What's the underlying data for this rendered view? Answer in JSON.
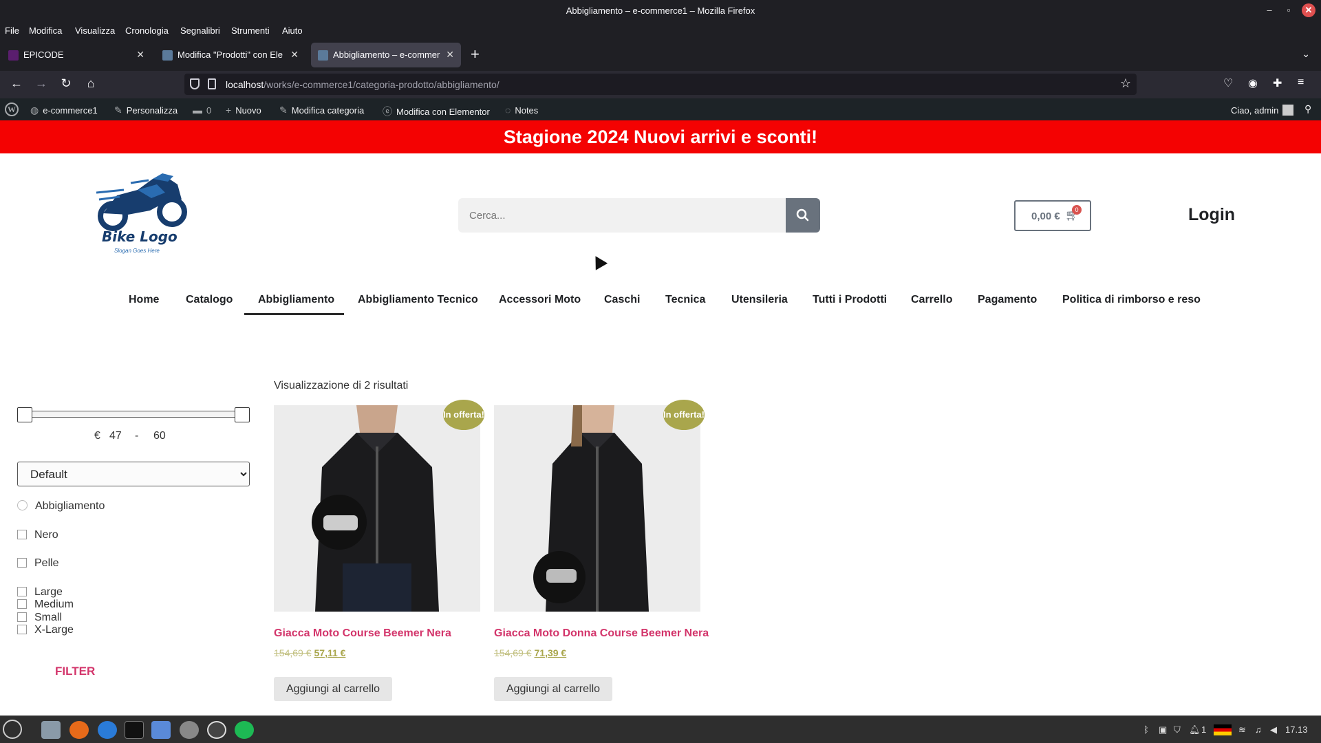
{
  "window": {
    "title": "Abbigliamento – e-commerce1 – Mozilla Firefox"
  },
  "menu": [
    "File",
    "Modifica",
    "Visualizza",
    "Cronologia",
    "Segnalibri",
    "Strumenti",
    "Aiuto"
  ],
  "tabs": [
    {
      "label": "EPICODE"
    },
    {
      "label": "Modifica \"Prodotti\" con Ele"
    },
    {
      "label": "Abbigliamento – e-commer"
    }
  ],
  "url": {
    "host": "localhost",
    "path": "/works/e-commerce1/categoria-prodotto/abbigliamento/"
  },
  "adminbar": {
    "site": "e-commerce1",
    "customize": "Personalizza",
    "comments": "0",
    "new": "Nuovo",
    "edit_category": "Modifica categoria",
    "elementor": "Modifica con Elementor",
    "notes": "Notes",
    "greeting": "Ciao, admin"
  },
  "promo": "Stagione 2024 Nuovi arrivi e sconti!",
  "logo": {
    "brand": "Bike Logo",
    "slogan": "Slogan Goes Here"
  },
  "search": {
    "placeholder": "Cerca..."
  },
  "cart": {
    "amount": "0,00 €",
    "count": "0"
  },
  "login": "Login",
  "nav": [
    "Home",
    "Catalogo",
    "Abbigliamento",
    "Abbigliamento Tecnico",
    "Accessori Moto",
    "Caschi",
    "Tecnica",
    "Utensileria",
    "Tutti i Prodotti",
    "Carrello",
    "Pagamento",
    "Politica di rimborso e reso"
  ],
  "filters": {
    "currency": "€",
    "min": "47",
    "sep": "-",
    "max": "60",
    "sort": "Default",
    "category": "Abbigliamento",
    "color": "Nero",
    "material": "Pelle",
    "sizes": [
      "Large",
      "Medium",
      "Small",
      "X-Large"
    ],
    "filter_label": "FILTER"
  },
  "results": "Visualizzazione di 2 risultati",
  "products": [
    {
      "name": "Giacca Moto Course Beemer Nera",
      "old_price": "154,69 €",
      "new_price": "57,11 €",
      "badge": "In offerta!",
      "button": "Aggiungi al carrello"
    },
    {
      "name": "Giacca Moto Donna Course Beemer Nera",
      "old_price": "154,69 €",
      "new_price": "71,39 €",
      "badge": "In offerta!",
      "button": "Aggiungi al carrello"
    }
  ],
  "clock": "17.13",
  "tray_count": "1"
}
